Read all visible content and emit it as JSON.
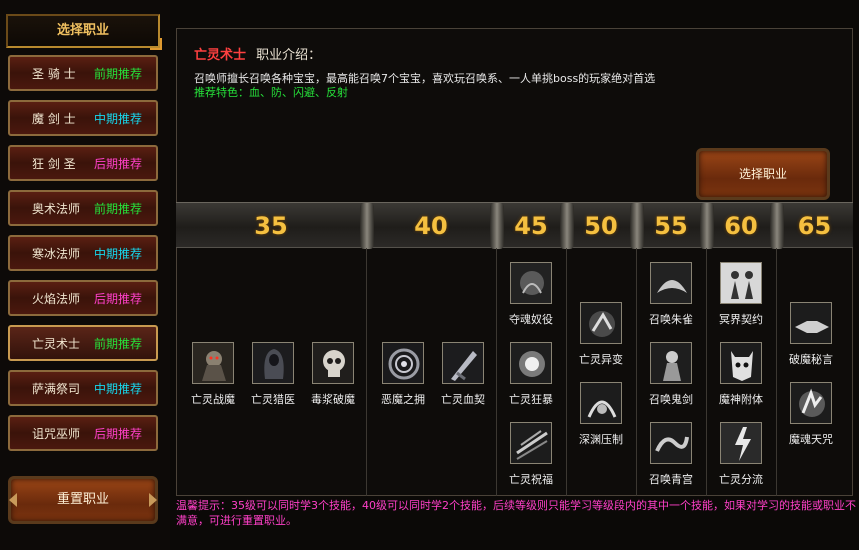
{
  "left": {
    "title": "选择职业",
    "classes": [
      {
        "name": "圣 骑 士",
        "rec": "前期推荐"
      },
      {
        "name": "魔 剑 士",
        "rec": "中期推荐"
      },
      {
        "name": "狂 剑 圣",
        "rec": "后期推荐"
      },
      {
        "name": "奥术法师",
        "rec": "前期推荐"
      },
      {
        "name": "寒冰法师",
        "rec": "中期推荐"
      },
      {
        "name": "火焰法师",
        "rec": "后期推荐"
      },
      {
        "name": "亡灵术士",
        "rec": "前期推荐"
      },
      {
        "name": "萨满祭司",
        "rec": "中期推荐"
      },
      {
        "name": "诅咒巫师",
        "rec": "后期推荐"
      }
    ],
    "selected_index": 6,
    "reset_label": "重置职业"
  },
  "intro": {
    "class_name": "亡灵术士",
    "label": "职业介绍：",
    "description": "召唤师擅长召唤各种宝宝，最高能召唤7个宝宝，喜欢玩召唤系、一人单挑boss的玩家绝对首选",
    "features": "推荐特色：血、防、闪避、反射"
  },
  "select_label": "选择职业",
  "levels": [
    "35",
    "40",
    "45",
    "50",
    "55",
    "60",
    "65"
  ],
  "skills": {
    "lv35": [
      "亡灵战魔",
      "亡灵猎医",
      "毒浆破魔"
    ],
    "lv40": [
      "恶魔之拥",
      "亡灵血契"
    ],
    "lv45": [
      "夺魂奴役",
      "亡灵狂暴",
      "亡灵祝福"
    ],
    "lv50": [
      "亡灵异变",
      "深渊压制"
    ],
    "lv55": [
      "召唤朱雀",
      "召唤鬼剑",
      "召唤青宫"
    ],
    "lv60": [
      "冥界契约",
      "魔神附体",
      "亡灵分流"
    ],
    "lv65": [
      "破魔秘言",
      "魔魂天咒"
    ]
  },
  "tip": "温馨提示：35级可以同时学3个技能，40级可以同时学2个技能，后续等级则只能学习等级段内的其中一个技能，如果对学习的技能或职业不满意，可进行重置职业。",
  "colors": {
    "rec_early": "#26e23a",
    "rec_mid": "#17d8ee",
    "rec_late": "#ff40c8",
    "class_name": "#ff4040",
    "level_number": "#f5c040"
  }
}
